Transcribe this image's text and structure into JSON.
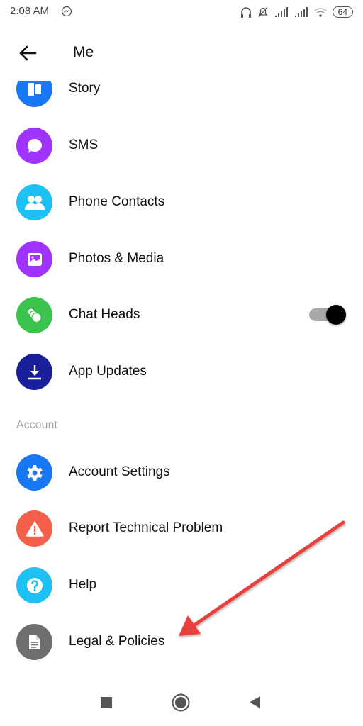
{
  "status_bar": {
    "time": "2:08 AM",
    "notification_icon": "messenger-icon",
    "icons": [
      "headphones-icon",
      "bell-muted-icon",
      "signal-icon",
      "signal-icon",
      "wifi-icon"
    ],
    "battery": "64"
  },
  "app_bar": {
    "back_icon": "arrow-left-icon",
    "title": "Me"
  },
  "items": [
    {
      "label": "Story",
      "icon": "story-icon",
      "color": "#1877F2"
    },
    {
      "label": "SMS",
      "icon": "chat-bubble-icon",
      "color": "#A033FF"
    },
    {
      "label": "Phone Contacts",
      "icon": "people-icon",
      "color": "#1EC1F4"
    },
    {
      "label": "Photos & Media",
      "icon": "image-icon",
      "color": "#A033FF"
    },
    {
      "label": "Chat Heads",
      "icon": "chat-heads-icon",
      "color": "#3AC44E",
      "toggle": true
    },
    {
      "label": "App Updates",
      "icon": "download-icon",
      "color": "#1A1F9A"
    }
  ],
  "section_account": {
    "title": "Account",
    "items": [
      {
        "label": "Account Settings",
        "icon": "gear-icon",
        "color": "#1877F2"
      },
      {
        "label": "Report Technical Problem",
        "icon": "warning-icon",
        "color": "#F35F4A"
      },
      {
        "label": "Help",
        "icon": "help-icon",
        "color": "#1EC1F4"
      },
      {
        "label": "Legal & Policies",
        "icon": "document-icon",
        "color": "#6E6E6E"
      }
    ]
  },
  "annotation": {
    "type": "arrow",
    "color": "#E8413E",
    "points_to": "Legal & Policies"
  },
  "nav_bar": {
    "buttons": [
      "recents-square-icon",
      "home-circle-icon",
      "back-triangle-icon"
    ]
  }
}
